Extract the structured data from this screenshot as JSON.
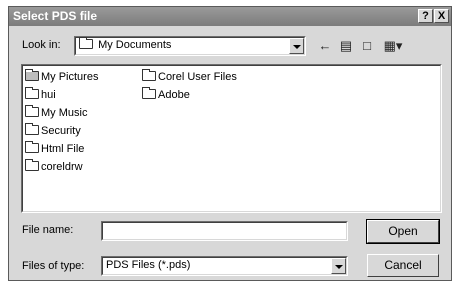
{
  "window": {
    "title": "Select PDS file",
    "help_label": "?",
    "close_label": "X"
  },
  "lookin": {
    "label": "Look in:",
    "value": "My Documents",
    "icon": "folder-open-icon"
  },
  "toolbar": {
    "back_icon": "back-arrow-icon",
    "up_icon": "up-folder-icon",
    "new_folder_icon": "new-folder-icon",
    "view_menu_icon": "view-menu-icon"
  },
  "files": {
    "column1": [
      "My Pictures",
      "hui",
      "My Music",
      "Security",
      "Html File",
      "coreldrw"
    ],
    "column2": [
      "Corel User Files",
      "Adobe"
    ]
  },
  "filename": {
    "label": "File name:",
    "value": ""
  },
  "filetype": {
    "label": "Files of type:",
    "value": "PDS Files (*.pds)"
  },
  "buttons": {
    "open": "Open",
    "cancel": "Cancel"
  }
}
